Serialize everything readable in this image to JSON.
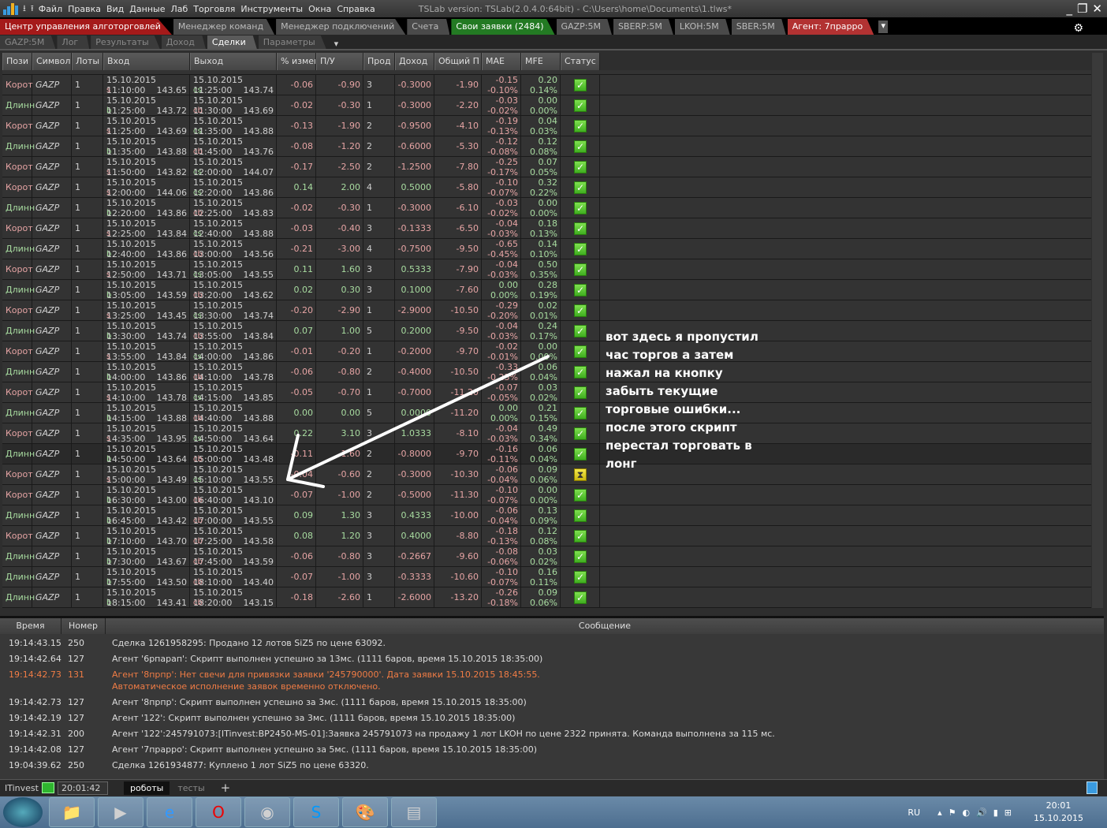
{
  "titlebar": {
    "menu": [
      "Файл",
      "Правка",
      "Вид",
      "Данные",
      "Лаб",
      "Торговля",
      "Инструменты",
      "Окна",
      "Справка"
    ],
    "version": "TSLab version:  TSLab(2.0.4.0:64bit) - C:\\Users\\home\\Documents\\1.tlws*"
  },
  "tabs_main": [
    "Центр управления алготорговлей",
    "Менеджер команд",
    "Менеджер подключений",
    "Счета",
    "Свои заявки (2484)",
    "GAZP:5M",
    "SBERP:5M",
    "LKOH:5M",
    "SBER:5M",
    "Агент: 7прарро"
  ],
  "tabs_sub": [
    "GAZP:5M",
    "Лог",
    "Результаты",
    "Доход",
    "Сделки",
    "Параметры"
  ],
  "columns": [
    "Пози",
    "Символ",
    "Лоты",
    "Вход",
    "Выход",
    "% измен",
    "П/У",
    "Прод",
    "Доход",
    "Общий П",
    "MAE",
    "MFE",
    "Статус"
  ],
  "trades": [
    [
      "Корот",
      "GAZP",
      "1",
      "15.10.2015 11:10:00",
      "s",
      "143.65",
      "15.10.2015 11:25:00",
      "cs",
      "143.74",
      "-0.06",
      "-0.90",
      "3",
      "-0.3000",
      "-1.90",
      "-0.15",
      "-0.10%",
      "0.20",
      "0.14%",
      "ok"
    ],
    [
      "Длинн",
      "GAZP",
      "1",
      "15.10.2015 11:25:00",
      "b",
      "143.72",
      "15.10.2015 11:30:00",
      "cb",
      "143.69",
      "-0.02",
      "-0.30",
      "1",
      "-0.3000",
      "-2.20",
      "-0.03",
      "-0.02%",
      "0.00",
      "0.00%",
      "ok"
    ],
    [
      "Корот",
      "GAZP",
      "1",
      "15.10.2015 11:25:00",
      "s",
      "143.69",
      "15.10.2015 11:35:00",
      "cs",
      "143.88",
      "-0.13",
      "-1.90",
      "2",
      "-0.9500",
      "-4.10",
      "-0.19",
      "-0.13%",
      "0.04",
      "0.03%",
      "ok"
    ],
    [
      "Длинн",
      "GAZP",
      "1",
      "15.10.2015 11:35:00",
      "b",
      "143.88",
      "15.10.2015 11:45:00",
      "cb",
      "143.76",
      "-0.08",
      "-1.20",
      "2",
      "-0.6000",
      "-5.30",
      "-0.12",
      "-0.08%",
      "0.12",
      "0.08%",
      "ok"
    ],
    [
      "Корот",
      "GAZP",
      "1",
      "15.10.2015 11:50:00",
      "s",
      "143.82",
      "15.10.2015 12:00:00",
      "cs",
      "144.07",
      "-0.17",
      "-2.50",
      "2",
      "-1.2500",
      "-7.80",
      "-0.25",
      "-0.17%",
      "0.07",
      "0.05%",
      "ok"
    ],
    [
      "Корот",
      "GAZP",
      "1",
      "15.10.2015 12:00:00",
      "s",
      "144.06",
      "15.10.2015 12:20:00",
      "cs",
      "143.86",
      "0.14",
      "2.00",
      "4",
      "0.5000",
      "-5.80",
      "-0.10",
      "-0.07%",
      "0.32",
      "0.22%",
      "ok"
    ],
    [
      "Длинн",
      "GAZP",
      "1",
      "15.10.2015 12:20:00",
      "b",
      "143.86",
      "15.10.2015 12:25:00",
      "cb",
      "143.83",
      "-0.02",
      "-0.30",
      "1",
      "-0.3000",
      "-6.10",
      "-0.03",
      "-0.02%",
      "0.00",
      "0.00%",
      "ok"
    ],
    [
      "Корот",
      "GAZP",
      "1",
      "15.10.2015 12:25:00",
      "s",
      "143.84",
      "15.10.2015 12:40:00",
      "cs",
      "143.88",
      "-0.03",
      "-0.40",
      "3",
      "-0.1333",
      "-6.50",
      "-0.04",
      "-0.03%",
      "0.18",
      "0.13%",
      "ok"
    ],
    [
      "Длинн",
      "GAZP",
      "1",
      "15.10.2015 12:40:00",
      "b",
      "143.86",
      "15.10.2015 13:00:00",
      "cb",
      "143.56",
      "-0.21",
      "-3.00",
      "4",
      "-0.7500",
      "-9.50",
      "-0.65",
      "-0.45%",
      "0.14",
      "0.10%",
      "ok"
    ],
    [
      "Корот",
      "GAZP",
      "1",
      "15.10.2015 12:50:00",
      "s",
      "143.71",
      "15.10.2015 13:05:00",
      "cs",
      "143.55",
      "0.11",
      "1.60",
      "3",
      "0.5333",
      "-7.90",
      "-0.04",
      "-0.03%",
      "0.50",
      "0.35%",
      "ok"
    ],
    [
      "Длинн",
      "GAZP",
      "1",
      "15.10.2015 13:05:00",
      "b",
      "143.59",
      "15.10.2015 13:20:00",
      "cb",
      "143.62",
      "0.02",
      "0.30",
      "3",
      "0.1000",
      "-7.60",
      "0.00",
      "0.00%",
      "0.28",
      "0.19%",
      "ok"
    ],
    [
      "Корот",
      "GAZP",
      "1",
      "15.10.2015 13:25:00",
      "s",
      "143.45",
      "15.10.2015 13:30:00",
      "cs",
      "143.74",
      "-0.20",
      "-2.90",
      "1",
      "-2.9000",
      "-10.50",
      "-0.29",
      "-0.20%",
      "0.02",
      "0.01%",
      "ok"
    ],
    [
      "Длинн",
      "GAZP",
      "1",
      "15.10.2015 13:30:00",
      "b",
      "143.74",
      "15.10.2015 13:55:00",
      "cb",
      "143.84",
      "0.07",
      "1.00",
      "5",
      "0.2000",
      "-9.50",
      "-0.04",
      "-0.03%",
      "0.24",
      "0.17%",
      "ok"
    ],
    [
      "Корот",
      "GAZP",
      "1",
      "15.10.2015 13:55:00",
      "s",
      "143.84",
      "15.10.2015 14:00:00",
      "cs",
      "143.86",
      "-0.01",
      "-0.20",
      "1",
      "-0.2000",
      "-9.70",
      "-0.02",
      "-0.01%",
      "0.00",
      "0.00%",
      "ok"
    ],
    [
      "Длинн",
      "GAZP",
      "1",
      "15.10.2015 14:00:00",
      "b",
      "143.86",
      "15.10.2015 14:10:00",
      "cb",
      "143.78",
      "-0.06",
      "-0.80",
      "2",
      "-0.4000",
      "-10.50",
      "-0.33",
      "-0.23%",
      "0.06",
      "0.04%",
      "ok"
    ],
    [
      "Корот",
      "GAZP",
      "1",
      "15.10.2015 14:10:00",
      "s",
      "143.78",
      "15.10.2015 14:15:00",
      "cs",
      "143.85",
      "-0.05",
      "-0.70",
      "1",
      "-0.7000",
      "-11.20",
      "-0.07",
      "-0.05%",
      "0.03",
      "0.02%",
      "ok"
    ],
    [
      "Длинн",
      "GAZP",
      "1",
      "15.10.2015 14:15:00",
      "b",
      "143.88",
      "15.10.2015 14:40:00",
      "cb",
      "143.88",
      "0.00",
      "0.00",
      "5",
      "0.0000",
      "-11.20",
      "0.00",
      "0.00%",
      "0.21",
      "0.15%",
      "ok"
    ],
    [
      "Корот",
      "GAZP",
      "1",
      "15.10.2015 14:35:00",
      "s",
      "143.95",
      "15.10.2015 14:50:00",
      "cs",
      "143.64",
      "0.22",
      "3.10",
      "3",
      "1.0333",
      "-8.10",
      "-0.04",
      "-0.03%",
      "0.49",
      "0.34%",
      "ok"
    ],
    [
      "Длинн",
      "GAZP",
      "1",
      "15.10.2015 14:50:00",
      "b",
      "143.64",
      "15.10.2015 15:00:00",
      "cb",
      "143.48",
      "-0.11",
      "-1.60",
      "2",
      "-0.8000",
      "-9.70",
      "-0.16",
      "-0.11%",
      "0.06",
      "0.04%",
      "ok"
    ],
    [
      "Корот",
      "GAZP",
      "1",
      "15.10.2015 15:00:00",
      "s",
      "143.49",
      "15.10.2015 15:10:00",
      "cs",
      "143.55",
      "-0.04",
      "-0.60",
      "2",
      "-0.3000",
      "-10.30",
      "-0.06",
      "-0.04%",
      "0.09",
      "0.06%",
      "pending"
    ],
    [
      "Корот",
      "GAZP",
      "1",
      "15.10.2015 16:30:00",
      "b",
      "143.00",
      "15.10.2015 16:40:00",
      "cb",
      "143.10",
      "-0.07",
      "-1.00",
      "2",
      "-0.5000",
      "-11.30",
      "-0.10",
      "-0.07%",
      "0.00",
      "0.00%",
      "ok"
    ],
    [
      "Длинн",
      "GAZP",
      "1",
      "15.10.2015 16:45:00",
      "b",
      "143.42",
      "15.10.2015 17:00:00",
      "cb",
      "143.55",
      "0.09",
      "1.30",
      "3",
      "0.4333",
      "-10.00",
      "-0.06",
      "-0.04%",
      "0.13",
      "0.09%",
      "ok"
    ],
    [
      "Корот",
      "GAZP",
      "1",
      "15.10.2015 17:10:00",
      "b",
      "143.70",
      "15.10.2015 17:25:00",
      "cb",
      "143.58",
      "0.08",
      "1.20",
      "3",
      "0.4000",
      "-8.80",
      "-0.18",
      "-0.13%",
      "0.12",
      "0.08%",
      "ok"
    ],
    [
      "Длинн",
      "GAZP",
      "1",
      "15.10.2015 17:30:00",
      "b",
      "143.67",
      "15.10.2015 17:45:00",
      "cb",
      "143.59",
      "-0.06",
      "-0.80",
      "3",
      "-0.2667",
      "-9.60",
      "-0.08",
      "-0.06%",
      "0.03",
      "0.02%",
      "ok"
    ],
    [
      "Длинн",
      "GAZP",
      "1",
      "15.10.2015 17:55:00",
      "b",
      "143.50",
      "15.10.2015 18:10:00",
      "cb",
      "143.40",
      "-0.07",
      "-1.00",
      "3",
      "-0.3333",
      "-10.60",
      "-0.10",
      "-0.07%",
      "0.16",
      "0.11%",
      "ok"
    ],
    [
      "Длинн",
      "GAZP",
      "1",
      "15.10.2015 18:15:00",
      "b",
      "143.41",
      "15.10.2015 18:20:00",
      "cb",
      "143.15",
      "-0.18",
      "-2.60",
      "1",
      "-2.6000",
      "-13.20",
      "-0.26",
      "-0.18%",
      "0.09",
      "0.06%",
      "ok"
    ]
  ],
  "annotation": [
    "вот здесь я пропустил",
    "час торгов а затем",
    "нажал на кнопку",
    "забыть текущие",
    "торговые ошибки...",
    "после этого скрипт",
    "перестал торговать в",
    "лонг"
  ],
  "log": {
    "headers": [
      "Время",
      "Номер",
      "Сообщение"
    ],
    "rows": [
      {
        "time": "19:14:43.15",
        "num": "250",
        "msg": "Сделка 1261958295: Продано 12 лотов SiZ5 по цене 63092."
      },
      {
        "time": "19:14:42.64",
        "num": "127",
        "msg": "Агент '6рпарап': Скрипт выполнен успешно за 13мс. (1111 баров, время 15.10.2015 18:35:00)"
      },
      {
        "time": "19:14:42.73",
        "num": "131",
        "msg": "Агент '8прпр': Нет свечи для привязки заявки  '245790000'. Дата заявки 15.10.2015 18:45:55.",
        "msg2": "Автоматическое исполнение заявок временно отключено.",
        "error": true
      },
      {
        "time": "19:14:42.73",
        "num": "127",
        "msg": "Агент '8прпр': Скрипт выполнен успешно за 3мс. (1111 баров, время 15.10.2015 18:35:00)"
      },
      {
        "time": "19:14:42.19",
        "num": "127",
        "msg": "Агент '122': Скрипт выполнен успешно за 3мс. (1111 баров, время 15.10.2015 18:35:00)"
      },
      {
        "time": "19:14:42.31",
        "num": "200",
        "msg": "Агент '122':245791073:[ITinvest:BP2450-MS-01]:Заявка 245791073 на продажу 1 лот LKOH по цене 2322 принята. Команда выполнена за 115 мс."
      },
      {
        "time": "19:14:42.08",
        "num": "127",
        "msg": "Агент '7прарро': Скрипт выполнен успешно за 5мс. (1111 баров, время 15.10.2015 18:35:00)"
      },
      {
        "time": "19:04:39.62",
        "num": "250",
        "msg": "Сделка 1261934877: Куплено 1 лот SiZ5 по цене 63320."
      }
    ]
  },
  "statusbar": {
    "broker": "ITinvest",
    "clock": "20:01:42",
    "tab_robots": "роботы",
    "tab_tests": "тесты"
  },
  "taskbar": {
    "lang": "RU",
    "time": "20:01",
    "date": "15.10.2015"
  }
}
